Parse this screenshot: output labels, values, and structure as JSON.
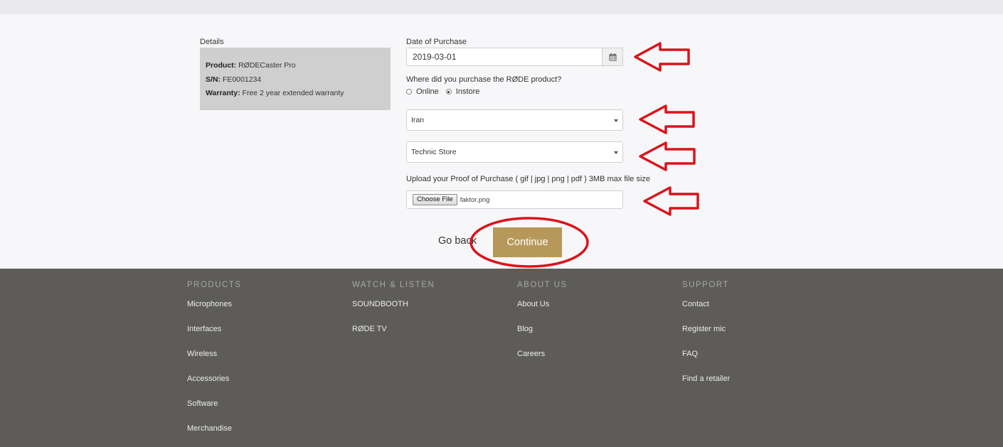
{
  "details": {
    "label": "Details",
    "product_label": "Product:",
    "product_value": "RØDECaster Pro",
    "sn_label": "S/N:",
    "sn_value": "FE0001234",
    "warranty_label": "Warranty:",
    "warranty_value": "Free 2 year extended warranty"
  },
  "form": {
    "date_label": "Date of Purchase",
    "date_value": "2019-03-01",
    "calendar_icon": "calendar-icon",
    "where_label": "Where did you purchase the RØDE product?",
    "options": [
      "Online",
      "Instore"
    ],
    "selected_option": "Instore",
    "country_value": "Iran",
    "store_value": "Technic Store",
    "upload_label": "Upload your Proof of Purchase ( gif | jpg | png | pdf ) 3MB max file size",
    "choose_file_label": "Choose File",
    "file_name": "faktor.png",
    "go_back_label": "Go back",
    "continue_label": "Continue"
  },
  "annotation": {
    "color": "#d9141c"
  },
  "footer": {
    "columns": [
      {
        "heading": "PRODUCTS",
        "links": [
          "Microphones",
          "Interfaces",
          "Wireless",
          "Accessories",
          "Software",
          "Merchandise"
        ]
      },
      {
        "heading": "WATCH & LISTEN",
        "links": [
          "SOUNDBOOTH",
          "RØDE TV"
        ]
      },
      {
        "heading": "ABOUT US",
        "links": [
          "About Us",
          "Blog",
          "Careers"
        ]
      },
      {
        "heading": "SUPPORT",
        "links": [
          "Contact",
          "Register mic",
          "FAQ",
          "Find a retailer"
        ]
      }
    ]
  },
  "colors": {
    "page_bg": "#f7f7f9",
    "details_bg": "#cfcfcf",
    "accent": "#b6995a",
    "footer_bg": "#5d5c58",
    "footer_heading": "#a8a8a3",
    "footer_link": "#ececea"
  }
}
